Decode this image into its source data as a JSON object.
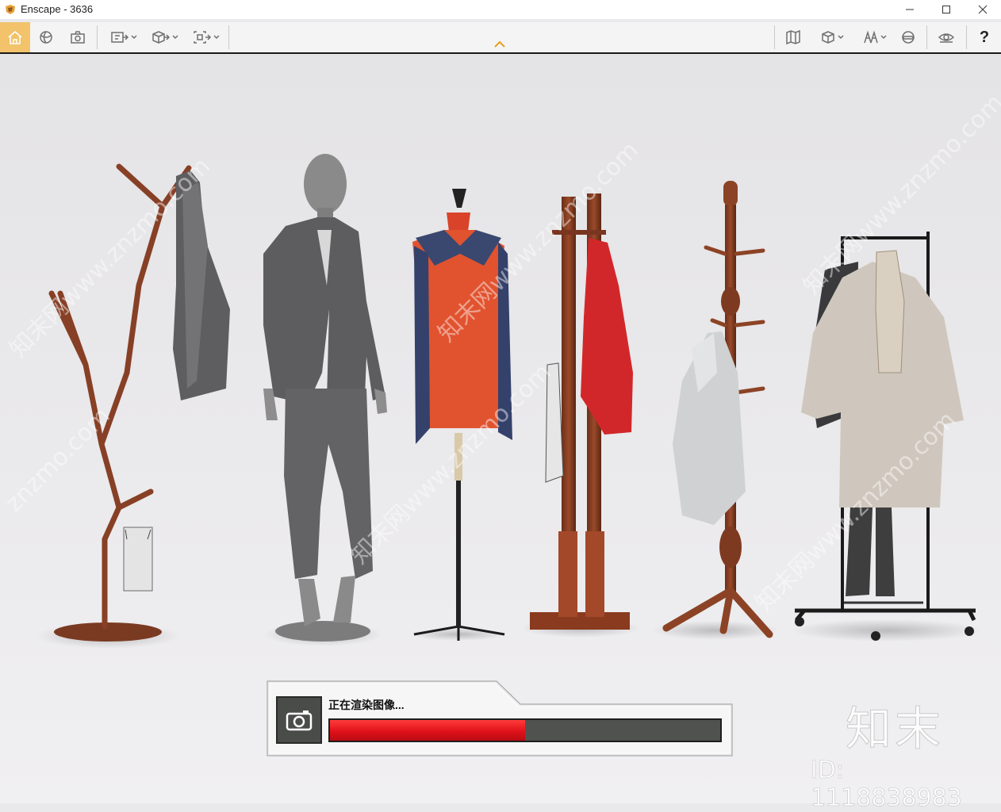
{
  "window": {
    "title": "Enscape - 3636",
    "controls": [
      "minimize-icon",
      "maximize-icon",
      "close-icon"
    ]
  },
  "toolbar": {
    "left_tools": [
      "home-icon",
      "orbit-icon",
      "screenshot-icon",
      "capture-dropdown-icon",
      "video-dropdown-icon",
      "batch-render-dropdown-icon"
    ],
    "center_toggle": "chevron-up-icon",
    "right_tools": [
      "map-icon",
      "asset-library-dropdown-icon",
      "atmosphere-dropdown-icon",
      "vr-headset-icon",
      "view-settings-icon"
    ],
    "help_label": "?"
  },
  "render_dialog": {
    "status_text": "正在渲染图像...",
    "progress": 0.5,
    "icon": "camera-icon"
  },
  "watermark": {
    "brand": "知末",
    "id_text": "ID: 1118838983",
    "site": "znzmo.com",
    "diagonal": "知末网www.znzmo.com"
  },
  "colors": {
    "accent": "#f2c36b",
    "progress": "#e0121a"
  }
}
